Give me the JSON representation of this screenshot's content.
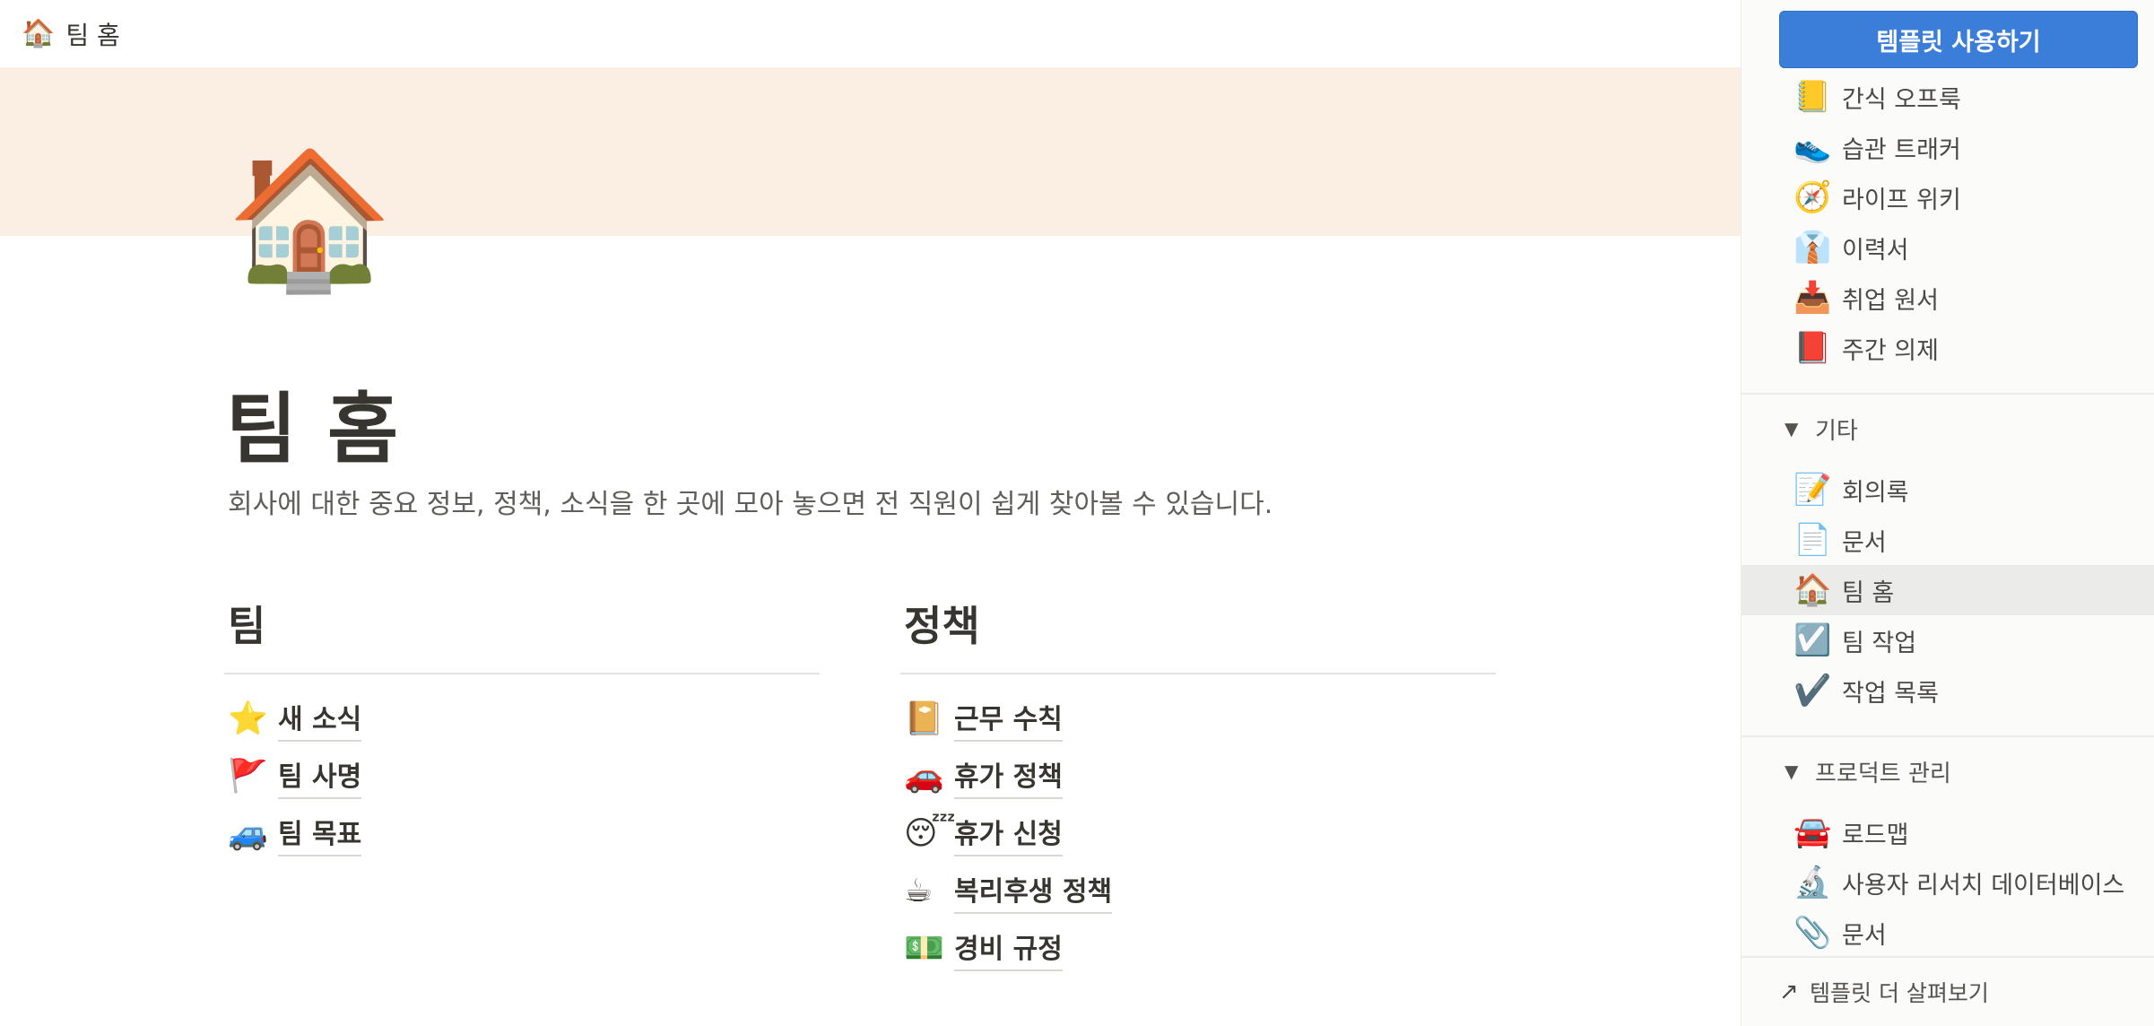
{
  "topbar": {
    "icon": "🏠",
    "title": "팀 홈"
  },
  "page": {
    "icon": "🏠",
    "title": "팀 홈",
    "description": "회사에 대한 중요 정보, 정책, 소식을 한 곳에 모아 놓으면 전 직원이 쉽게 찾아볼 수 있습니다."
  },
  "columns": {
    "team": {
      "heading": "팀",
      "items": [
        {
          "icon": "⭐",
          "label": "새 소식"
        },
        {
          "icon": "🚩",
          "label": "팀 사명"
        },
        {
          "icon": "🚙",
          "label": "팀 목표"
        }
      ]
    },
    "policy": {
      "heading": "정책",
      "items": [
        {
          "icon": "📔",
          "label": "근무 수칙"
        },
        {
          "icon": "🚗",
          "label": "휴가 정책"
        },
        {
          "icon": "😴",
          "label": "휴가 신청"
        },
        {
          "icon": "☕",
          "label": "복리후생 정책"
        },
        {
          "icon": "💵",
          "label": "경비 규정"
        }
      ]
    }
  },
  "sidebar": {
    "use_button": "템플릿 사용하기",
    "personal_items": [
      {
        "icon": "📒",
        "label": "간식 오프룩"
      },
      {
        "icon": "👟",
        "label": "습관 트래커"
      },
      {
        "icon": "🧭",
        "label": "라이프 위키"
      },
      {
        "icon": "👔",
        "label": "이력서"
      },
      {
        "icon": "📥",
        "label": "취업 원서"
      },
      {
        "icon": "📕",
        "label": "주간 의제"
      }
    ],
    "groups": [
      {
        "caret": "▼",
        "label": "기타",
        "items": [
          {
            "icon": "📝",
            "label": "회의록"
          },
          {
            "icon": "📄",
            "label": "문서"
          },
          {
            "icon": "🏠",
            "label": "팀 홈"
          },
          {
            "icon": "☑️",
            "label": "팀 작업"
          },
          {
            "icon": "✔️",
            "label": "작업 목록"
          }
        ]
      },
      {
        "caret": "▼",
        "label": "프로덕트 관리",
        "items": [
          {
            "icon": "🚘",
            "label": "로드맵"
          },
          {
            "icon": "🔬",
            "label": "사용자 리서치 데이터베이스"
          },
          {
            "icon": "📎",
            "label": "문서"
          }
        ]
      }
    ],
    "footer": {
      "arrow": "↗",
      "label": "템플릿 더 살펴보기"
    }
  }
}
